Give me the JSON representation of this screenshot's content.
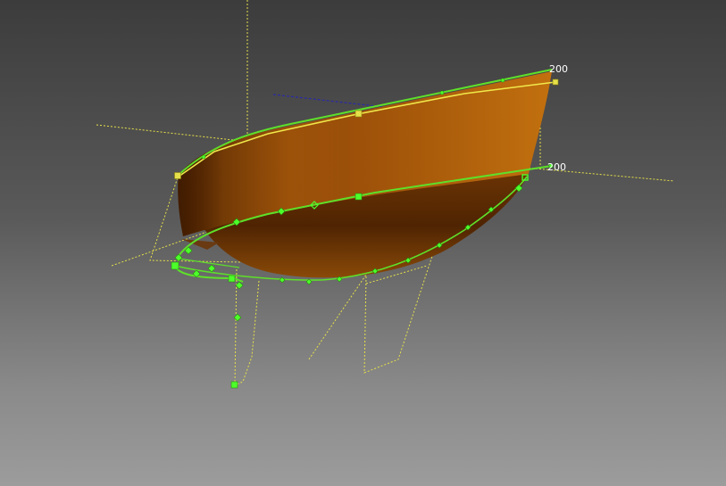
{
  "viewport": {
    "dimension_labels": {
      "top": "200",
      "middle": "200"
    },
    "colors": {
      "hull_surface": "#b3620a",
      "control_curve": "#5ee02a",
      "control_point": "#4dff2a",
      "construction_line": "#e6e04a",
      "axis_blue": "#2a2aa8",
      "background_top": "#3c3c3c",
      "background_bottom": "#9c9c9c"
    },
    "icons": {
      "control_point": "diamond-marker",
      "corner_point": "square-marker"
    }
  }
}
